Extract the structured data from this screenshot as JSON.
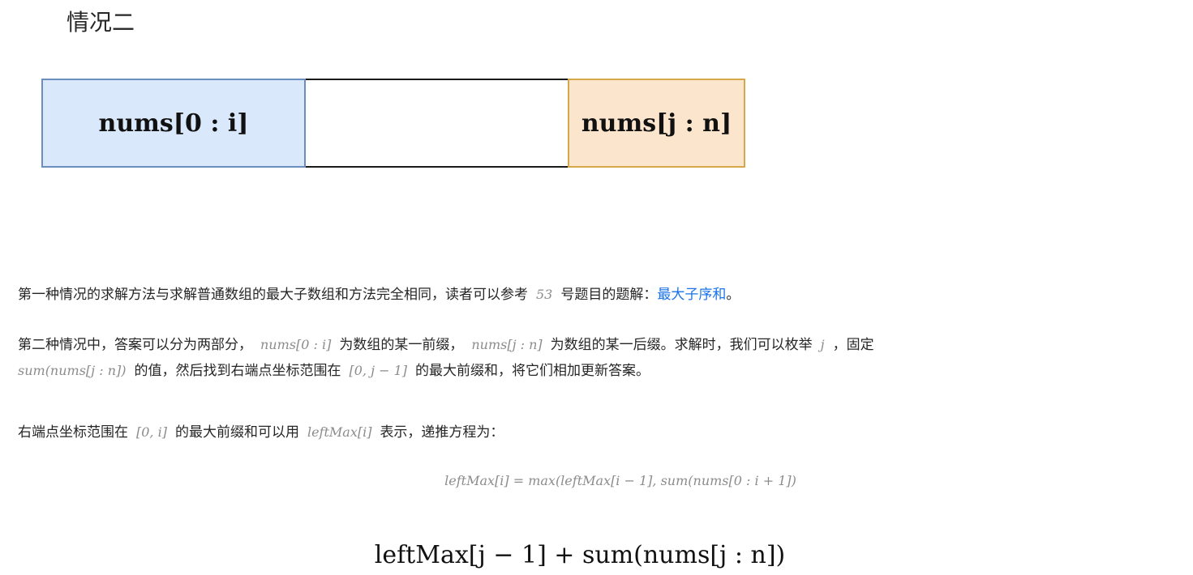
{
  "heading": "情况二",
  "diagram": {
    "left_label": "nums[0 : i]",
    "middle_label": "",
    "right_label": "nums[j : n]",
    "colors": {
      "left_fill": "#dae8fc",
      "left_border": "#6c8ebf",
      "right_fill": "#fce5cd",
      "right_border": "#d6a84b"
    }
  },
  "paragraph1": {
    "text_before": "第一种情况的求解方法与求解普通数组的最大子数组和方法完全相同，读者可以参考",
    "math": "53",
    "text_after": "号题目的题解：",
    "link": "最大子序和",
    "end": "。"
  },
  "paragraph2": {
    "t1": "第二种情况中，答案可以分为两部分，",
    "m1": "nums[0 : i]",
    "t2": "为数组的某一前缀，",
    "m2": "nums[j : n]",
    "t3": "为数组的某一后缀。求解时，我们可以枚举",
    "m3": "j",
    "t4": "，固定",
    "m4": "sum(nums[j : n])",
    "t5": "的值，然后找到右端点坐标范围在",
    "m5": "[0, j − 1]",
    "t6": "的最大前缀和，将它们相加更新答案。"
  },
  "paragraph3": {
    "t1": "右端点坐标范围在",
    "m1": "[0, i]",
    "t2": "的最大前缀和可以用",
    "m2": "leftMax[i]",
    "t3": "表示，递推方程为："
  },
  "equation1": "leftMax[i] = max(leftMax[i − 1], sum(nums[0 : i + 1])",
  "equation2": "leftMax[j − 1] + sum(nums[j : n])"
}
